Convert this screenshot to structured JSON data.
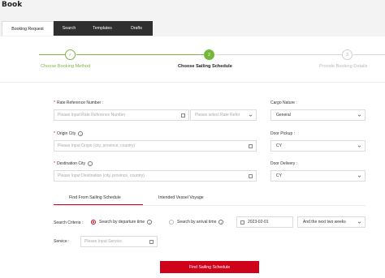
{
  "page": {
    "title": "Book"
  },
  "tabs": [
    {
      "label": "Booking Request"
    },
    {
      "label": "Search"
    },
    {
      "label": "Templates"
    },
    {
      "label": "Drafts"
    }
  ],
  "steps": [
    {
      "number": "✓",
      "label": "Choose Booking Method",
      "status": "done"
    },
    {
      "number": "2",
      "label": "Choose Sailing Schedule",
      "status": "active"
    },
    {
      "number": "3",
      "label": "Provide Booking Details",
      "status": "pending"
    }
  ],
  "colors": {
    "accent": "#d0021b",
    "done": "#7fb348",
    "active": "#75b73a"
  },
  "form": {
    "rate_reference": {
      "label": "Rate Reference Number :",
      "placeholder": "Please Input Rate Reference Number",
      "select_placeholder": "Please select Rate Refer"
    },
    "cargo_nature": {
      "label": "Cargo Nature :",
      "value": "General"
    },
    "origin_city": {
      "label": "Origin City",
      "placeholder": "Please Input Origin (city, province, country)"
    },
    "door_pickup": {
      "label": "Door Pickup :",
      "value": "CY"
    },
    "destination_city": {
      "label": "Destination City",
      "placeholder": "Please Input Destination (city, province, country)"
    },
    "door_delivery": {
      "label": "Door Delivery :",
      "value": "CY"
    }
  },
  "schedule_tabs": [
    {
      "label": "Find From Sailing Schedule"
    },
    {
      "label": "Intended Vessel Voyage"
    }
  ],
  "search": {
    "criteria_label": "Search Criteria :",
    "option_departure": "Search by departure time",
    "option_arrival": "Search by arrival time",
    "date_value": "2023-02-01",
    "range_value": "And the next two weeks",
    "service_label": "Service :",
    "service_placeholder": "Please Input Service"
  },
  "action": {
    "find_label": "Find Sailing Schedule"
  }
}
